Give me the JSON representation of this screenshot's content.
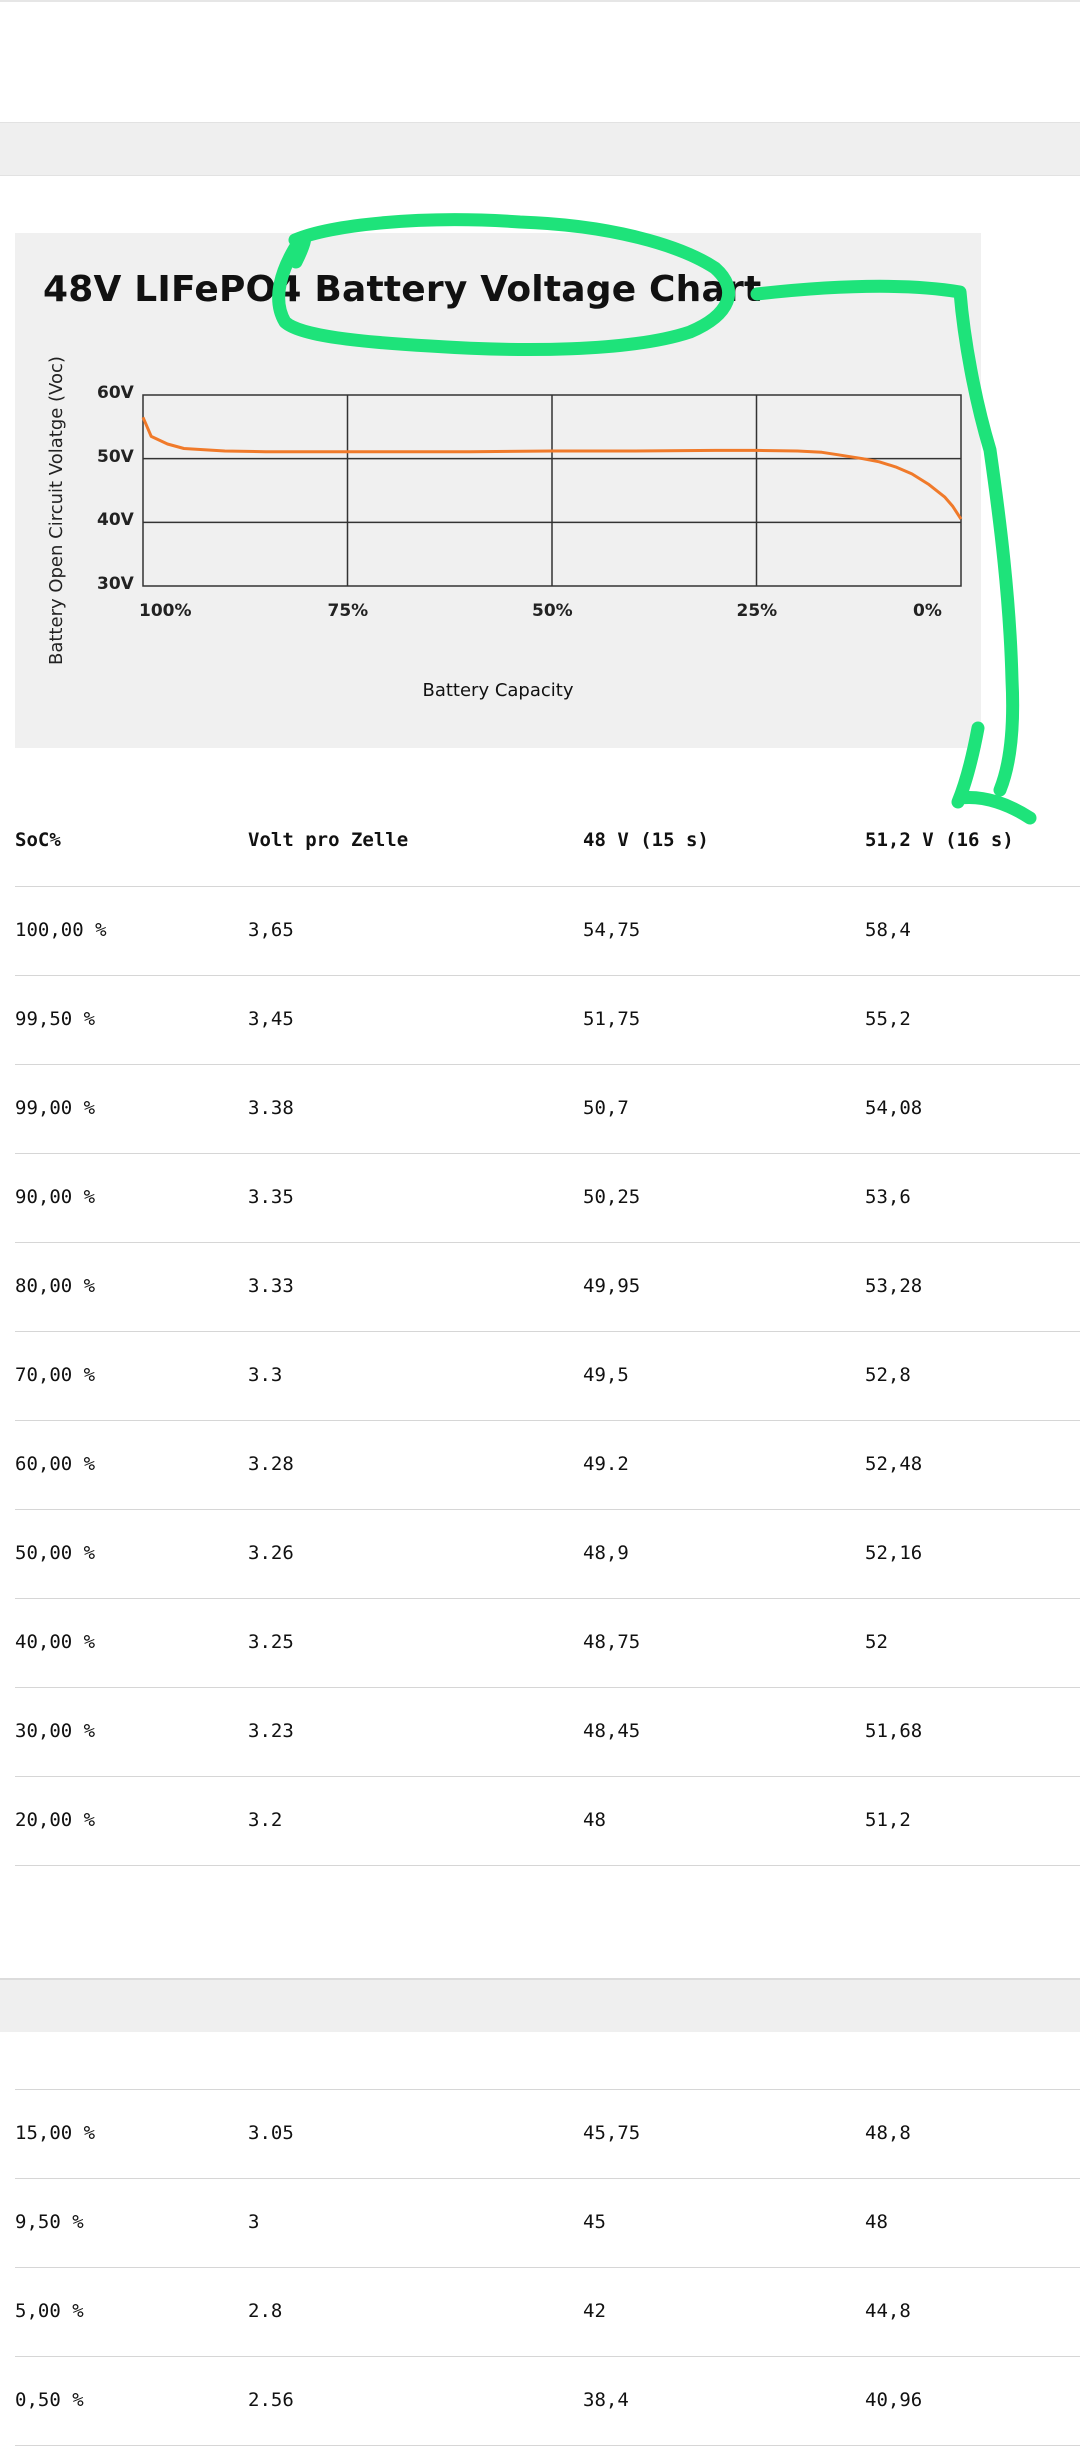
{
  "chart": {
    "title": "48V LIFePO4 Battery Voltage Chart",
    "y_title": "Battery Open Circuit Volatge (Voc)",
    "x_title": "Battery Capacity"
  },
  "chart_data": {
    "type": "line",
    "title": "48V LIFePO4 Battery Voltage Chart",
    "xlabel": "Battery Capacity",
    "ylabel": "Battery Open Circuit Volatge (Voc)",
    "x_ticks": [
      "100%",
      "75%",
      "50%",
      "25%",
      "0%"
    ],
    "y_ticks": [
      "60V",
      "50V",
      "40V",
      "30V"
    ],
    "ylim": [
      30,
      60
    ],
    "xlim": [
      100,
      0
    ],
    "grid": true,
    "series": [
      {
        "color": "#f07a2a",
        "x": [
          100,
          99.5,
          99,
          97,
          95,
          90,
          85,
          80,
          75,
          70,
          60,
          50,
          40,
          30,
          25,
          20,
          17,
          15,
          12,
          10,
          8,
          6,
          4,
          2,
          1,
          0
        ],
        "y": [
          56.5,
          55,
          53.5,
          52.3,
          51.6,
          51.2,
          51.1,
          51.1,
          51.1,
          51.1,
          51.1,
          51.2,
          51.2,
          51.3,
          51.3,
          51.2,
          51.0,
          50.6,
          50.0,
          49.5,
          48.7,
          47.6,
          46.0,
          44.0,
          42.5,
          40.5
        ]
      }
    ]
  },
  "table": {
    "headers": [
      "SoC%",
      "Volt pro Zelle",
      "48 V (15 s)",
      "51,2 V (16 s)"
    ],
    "rows": [
      [
        "100,00 %",
        "3,65",
        "54,75",
        "58,4"
      ],
      [
        "99,50 %",
        "3,45",
        "51,75",
        "55,2"
      ],
      [
        "99,00 %",
        "3.38",
        "50,7",
        "54,08"
      ],
      [
        "90,00 %",
        "3.35",
        "50,25",
        "53,6"
      ],
      [
        "80,00 %",
        "3.33",
        "49,95",
        "53,28"
      ],
      [
        "70,00 %",
        "3.3",
        "49,5",
        "52,8"
      ],
      [
        "60,00 %",
        "3.28",
        "49.2",
        "52,48"
      ],
      [
        "50,00 %",
        "3.26",
        "48,9",
        "52,16"
      ],
      [
        "40,00 %",
        "3.25",
        "48,75",
        "52"
      ],
      [
        "30,00 %",
        "3.23",
        "48,45",
        "51,68"
      ],
      [
        "20,00 %",
        "3.2",
        "48",
        "51,2"
      ]
    ],
    "rows2": [
      [
        "15,00 %",
        "3.05",
        "45,75",
        "48,8"
      ],
      [
        "9,50 %",
        "3",
        "45",
        "48"
      ],
      [
        "5,00 %",
        "2.8",
        "42",
        "44,8"
      ],
      [
        "0,50 %",
        "2.56",
        "38,4",
        "40,96"
      ]
    ]
  },
  "colors": {
    "annotation": "#1ee37a",
    "line": "#f07a2a",
    "chart_bg": "#f0f0f0"
  }
}
